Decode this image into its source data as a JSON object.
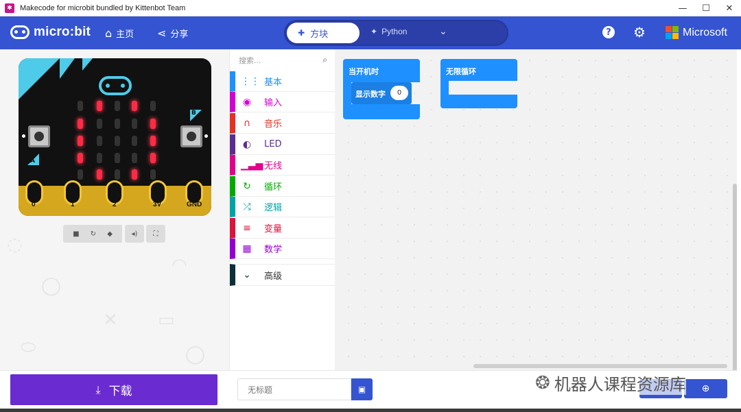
{
  "window": {
    "title": "Makecode for microbit bundled by Kittenbot Team",
    "controls": {
      "minimize": "—",
      "maximize": "☐",
      "close": "✕"
    }
  },
  "header": {
    "logo_text": "micro:bit",
    "home_label": "主页",
    "share_label": "分享",
    "blocks_tab": "方块",
    "python_tab": "Python",
    "help_symbol": "?",
    "brand": "Microsoft",
    "brand_colors": [
      "#f25022",
      "#7fba00",
      "#00a4ef",
      "#ffb900"
    ]
  },
  "simulator": {
    "button_a": "A",
    "button_b": "B",
    "pins": [
      "0",
      "1",
      "2",
      "3V",
      "GND"
    ],
    "led_matrix": [
      [
        0,
        1,
        0,
        1,
        0
      ],
      [
        1,
        0,
        0,
        0,
        1
      ],
      [
        1,
        0,
        0,
        0,
        1
      ],
      [
        1,
        0,
        0,
        0,
        1
      ],
      [
        0,
        1,
        0,
        1,
        0
      ]
    ],
    "controls": [
      "stop-icon",
      "restart-icon",
      "slowmo-icon",
      "sound-icon",
      "fullscreen-icon"
    ]
  },
  "toolbox": {
    "search_placeholder": "搜索...",
    "categories": [
      {
        "label": "基本",
        "color": "#1e90ff",
        "icon": "⋮⋮"
      },
      {
        "label": "输入",
        "color": "#d400d4",
        "icon": "◉"
      },
      {
        "label": "音乐",
        "color": "#e63022",
        "icon": "∩"
      },
      {
        "label": "LED",
        "color": "#5c2d91",
        "icon": "◐"
      },
      {
        "label": "无线",
        "color": "#e3008c",
        "icon": "▁▃▅"
      },
      {
        "label": "循环",
        "color": "#00aa00",
        "icon": "↻"
      },
      {
        "label": "逻辑",
        "color": "#00a4a6",
        "icon": "⤮"
      },
      {
        "label": "变量",
        "color": "#dc143c",
        "icon": "≡"
      },
      {
        "label": "数学",
        "color": "#9400d3",
        "icon": "▦"
      },
      {
        "label": "高级",
        "color": "#0c2f38",
        "icon": "⌄"
      }
    ]
  },
  "workspace": {
    "on_start_label": "当开机时",
    "show_number_label": "显示数字",
    "show_number_value": "0",
    "forever_label": "无限循环",
    "block_color": "#1e90ff"
  },
  "bottom": {
    "download_label": "下载",
    "project_name_placeholder": "无标题",
    "watermark": "机器人课程资源库"
  }
}
